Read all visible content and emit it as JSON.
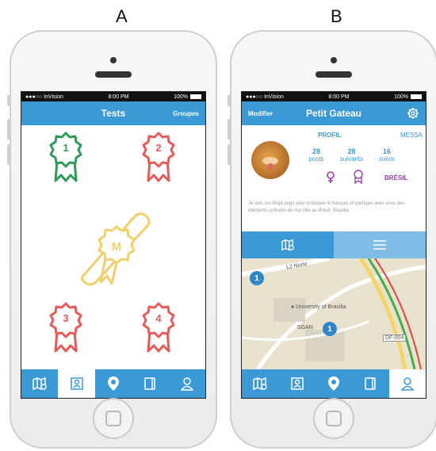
{
  "labels": {
    "a": "A",
    "b": "B"
  },
  "phone_a": {
    "status": {
      "carrier": "●●●○○ InVision",
      "time": "8:00 PM",
      "battery": "100%"
    },
    "nav": {
      "title": "Tests",
      "right": "Groupes"
    },
    "badges": [
      {
        "number": "1",
        "color": "#2f9a5a"
      },
      {
        "number": "2",
        "color": "#e85a5a"
      },
      {
        "number": "M",
        "color": "#f0d06a"
      },
      {
        "number": "3",
        "color": "#e85a5a"
      },
      {
        "number": "4",
        "color": "#e85a5a"
      }
    ],
    "tabs": [
      "map-search-icon",
      "id-card-icon",
      "location-pin-icon",
      "notebook-icon",
      "person-icon"
    ],
    "active_tab": 1
  },
  "phone_b": {
    "status": {
      "carrier": "●●●○○ InVision",
      "time": "8:00 PM",
      "battery": "100%"
    },
    "nav": {
      "left": "Modifier",
      "title": "Petit Gateau",
      "right_icon": "gear-icon"
    },
    "profile_tabs": {
      "profil": "PROFIL",
      "messages": "MESSA"
    },
    "stats": [
      {
        "value": "28",
        "label": "posts"
      },
      {
        "value": "28",
        "label": "suivants"
      },
      {
        "value": "16",
        "label": "suivis"
      }
    ],
    "country": "BRÉSIL",
    "bio": "Je suis sur MapLango pour pratiquer le français et partager avec vous des éléments culturels de ma ville au Brésil, Brasilia.",
    "map": {
      "place": "University of Brasilia",
      "road_1": "L2 Norte",
      "region": "SGAN",
      "road_2": "DF-004",
      "pins": [
        "1",
        "1"
      ]
    },
    "tabs": [
      "map-search-icon",
      "id-card-icon",
      "location-pin-icon",
      "notebook-icon",
      "person-icon"
    ],
    "active_tab": 4,
    "colors": {
      "accent": "#3b9ad6",
      "country": "#9b3fa8"
    }
  }
}
